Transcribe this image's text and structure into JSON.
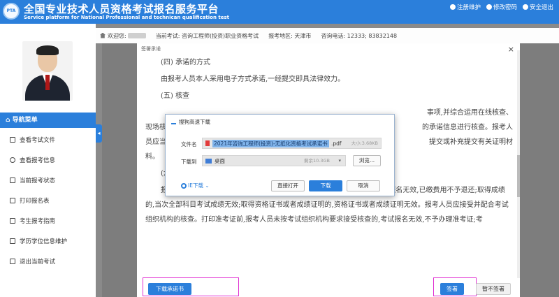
{
  "header": {
    "logo_text": "PTA",
    "title": "全国专业技术人员资格考试报名服务平台",
    "subtitle": "Service platform for National Professional and technican qualification test",
    "links": [
      {
        "icon": "info-icon",
        "label": "注册维护"
      },
      {
        "icon": "lock-icon",
        "label": "修改密码"
      },
      {
        "icon": "power-icon",
        "label": "安全退出"
      }
    ]
  },
  "infobar": {
    "welcome": "欢迎您:",
    "exam": "当前考试: 咨询工程师(投资)职业资格考试",
    "region": "报考地区: 天津市",
    "phone": "咨询电话: 12333; 83832148"
  },
  "sidebar": {
    "nav_header": "导航菜单",
    "items": [
      {
        "icon": "file-icon",
        "label": "查看考试文件"
      },
      {
        "icon": "info-icon",
        "label": "查看报考信息"
      },
      {
        "icon": "monitor-icon",
        "label": "当前报考状态"
      },
      {
        "icon": "printer-icon",
        "label": "打印报名表"
      },
      {
        "icon": "book-icon",
        "label": "考生报考指南"
      },
      {
        "icon": "graduation-icon",
        "label": "学历学位信息维护"
      },
      {
        "icon": "exit-icon",
        "label": "退出当前考试"
      }
    ]
  },
  "modal": {
    "title": "签署承诺",
    "close": "×",
    "doc": {
      "heading4": "(四) 承诺的方式",
      "para4": "由报考人员本人采用电子方式承诺,一经提交即具法律效力。",
      "heading5": "(五) 核查",
      "para5_line1": "事项,并综合运用在线核查、",
      "para5_line2": "现场核",
      "para5_line2b": "的承诺信息进行核查。报考人",
      "para5_line3": "员应当",
      "para5_line3b": "提交或补充提交有关证明材",
      "para5_line4": "料。",
      "heading6": "(六) 失信惩戒",
      "para6": "报考人员承诺后,在核查或者日常监管中发现其不符合考试报名条件的,考试报名无效,已缴费用不予退还;取得成绩的,当次全部科目考试成绩无效;取得资格证书或者成绩证明的,资格证书或者成绩证明无效。报考人员应接受并配合考试组织机构的核查。打印准考证前,报考人员未按考试组织机构要求接受核查的,考试报名无效,不予办理准考证;考"
    },
    "download_button": "下载承诺书",
    "sign_button": "签署",
    "nosign_button": "暂不签署"
  },
  "download_dialog": {
    "title": "搜狗高速下载",
    "filename_label": "文件名",
    "filename": "2021年咨询工程师(投资)-无纸化资格考试承诺书",
    "filename_ext": ".pdf",
    "file_size": "大小:3.68KB",
    "save_to_label": "下载到",
    "folder": "桌面",
    "free_space": "剩余10.3GB",
    "browse_button": "浏览...",
    "ie_download": "IE下载",
    "open_button": "直接打开",
    "download_button": "下载",
    "cancel_button": "取消"
  }
}
